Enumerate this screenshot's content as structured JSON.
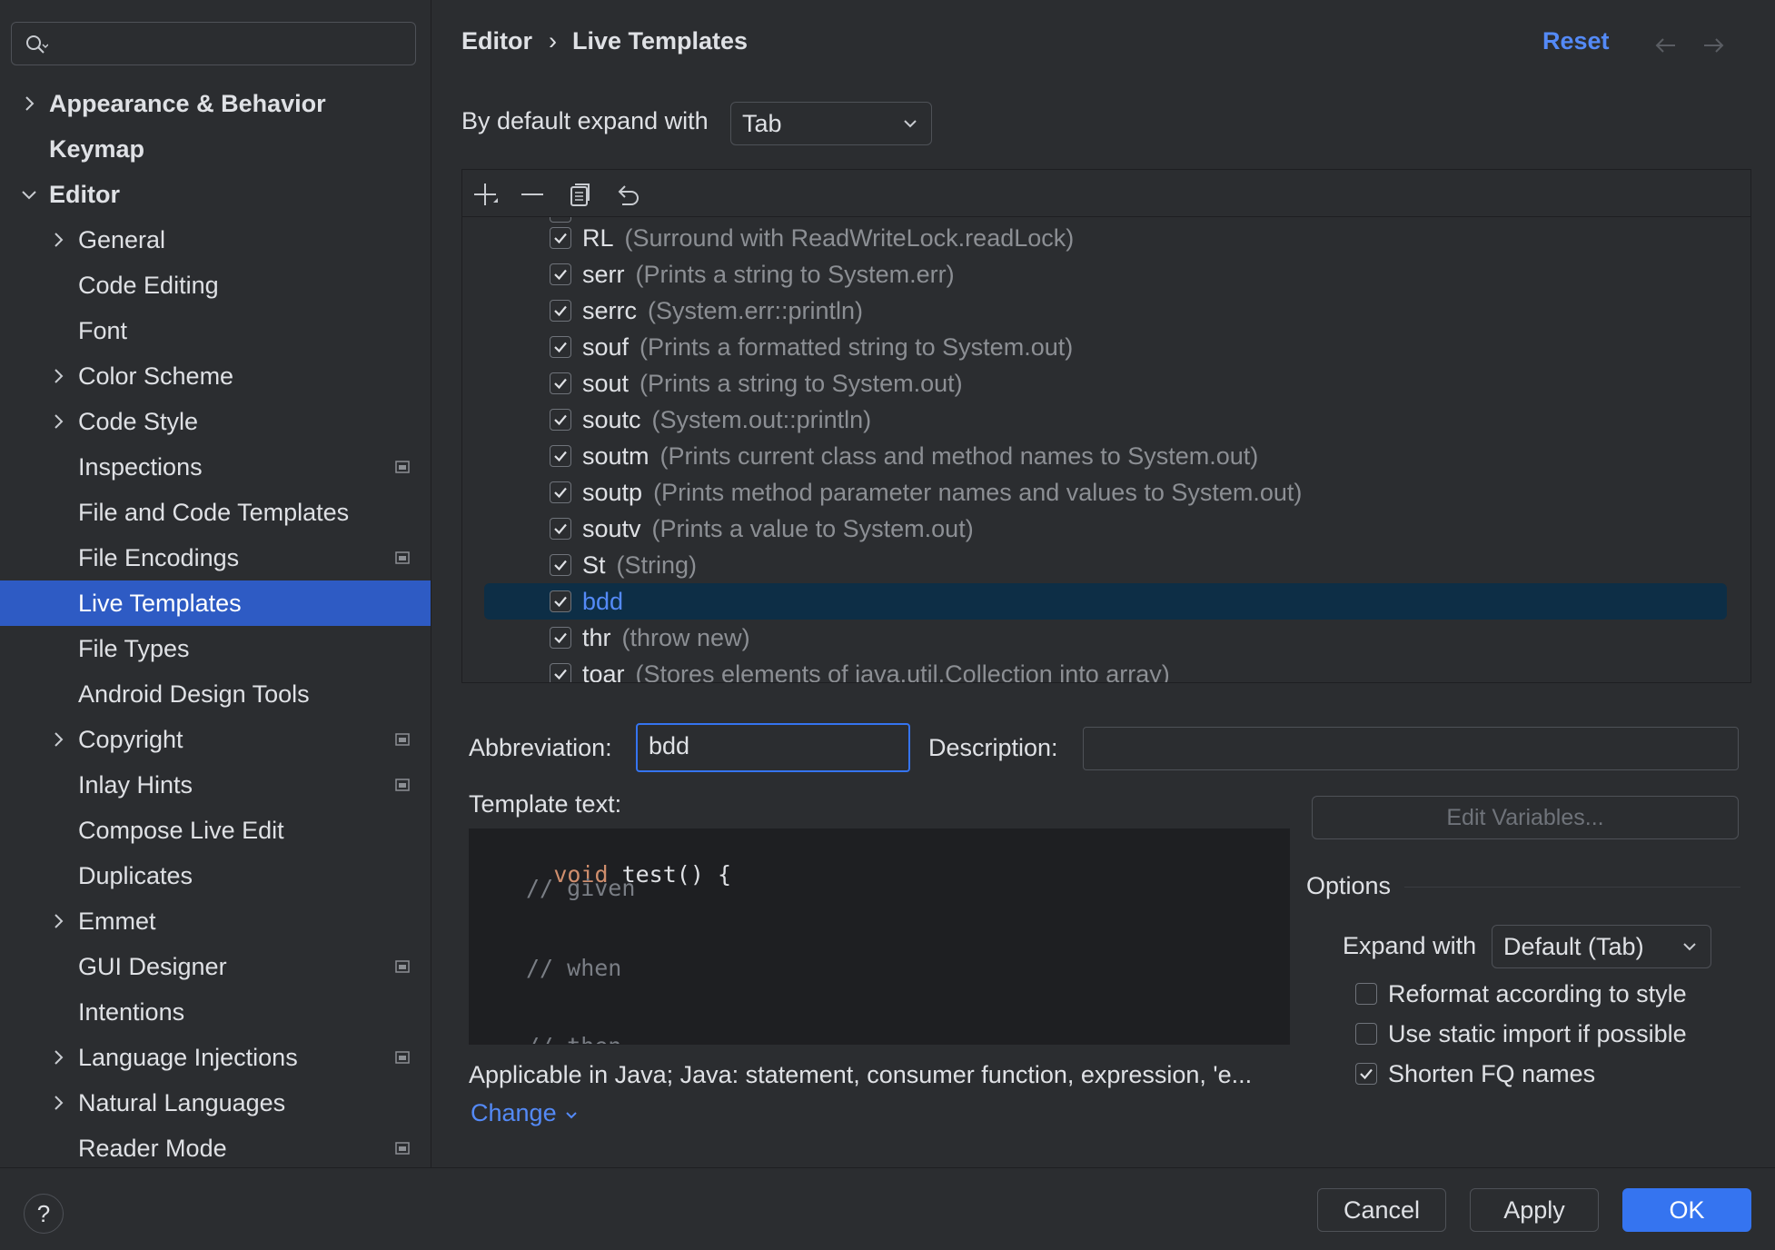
{
  "search": {
    "placeholder": ""
  },
  "sidebar": {
    "items": [
      {
        "label": "Appearance & Behavior",
        "level": 0,
        "expander": "collapsed",
        "bold": true,
        "project": false,
        "selected": false
      },
      {
        "label": "Keymap",
        "level": 0,
        "expander": "none",
        "bold": true,
        "project": false,
        "selected": false
      },
      {
        "label": "Editor",
        "level": 0,
        "expander": "expanded",
        "bold": true,
        "project": false,
        "selected": false
      },
      {
        "label": "General",
        "level": 1,
        "expander": "collapsed",
        "bold": false,
        "project": false,
        "selected": false
      },
      {
        "label": "Code Editing",
        "level": 1,
        "expander": "none",
        "bold": false,
        "project": false,
        "selected": false
      },
      {
        "label": "Font",
        "level": 1,
        "expander": "none",
        "bold": false,
        "project": false,
        "selected": false
      },
      {
        "label": "Color Scheme",
        "level": 1,
        "expander": "collapsed",
        "bold": false,
        "project": false,
        "selected": false
      },
      {
        "label": "Code Style",
        "level": 1,
        "expander": "collapsed",
        "bold": false,
        "project": false,
        "selected": false
      },
      {
        "label": "Inspections",
        "level": 1,
        "expander": "none",
        "bold": false,
        "project": true,
        "selected": false
      },
      {
        "label": "File and Code Templates",
        "level": 1,
        "expander": "none",
        "bold": false,
        "project": false,
        "selected": false
      },
      {
        "label": "File Encodings",
        "level": 1,
        "expander": "none",
        "bold": false,
        "project": true,
        "selected": false
      },
      {
        "label": "Live Templates",
        "level": 1,
        "expander": "none",
        "bold": false,
        "project": false,
        "selected": true
      },
      {
        "label": "File Types",
        "level": 1,
        "expander": "none",
        "bold": false,
        "project": false,
        "selected": false
      },
      {
        "label": "Android Design Tools",
        "level": 1,
        "expander": "none",
        "bold": false,
        "project": false,
        "selected": false
      },
      {
        "label": "Copyright",
        "level": 1,
        "expander": "collapsed",
        "bold": false,
        "project": true,
        "selected": false
      },
      {
        "label": "Inlay Hints",
        "level": 1,
        "expander": "none",
        "bold": false,
        "project": true,
        "selected": false
      },
      {
        "label": "Compose Live Edit",
        "level": 1,
        "expander": "none",
        "bold": false,
        "project": false,
        "selected": false
      },
      {
        "label": "Duplicates",
        "level": 1,
        "expander": "none",
        "bold": false,
        "project": false,
        "selected": false
      },
      {
        "label": "Emmet",
        "level": 1,
        "expander": "collapsed",
        "bold": false,
        "project": false,
        "selected": false
      },
      {
        "label": "GUI Designer",
        "level": 1,
        "expander": "none",
        "bold": false,
        "project": true,
        "selected": false
      },
      {
        "label": "Intentions",
        "level": 1,
        "expander": "none",
        "bold": false,
        "project": false,
        "selected": false
      },
      {
        "label": "Language Injections",
        "level": 1,
        "expander": "collapsed",
        "bold": false,
        "project": true,
        "selected": false
      },
      {
        "label": "Natural Languages",
        "level": 1,
        "expander": "collapsed",
        "bold": false,
        "project": false,
        "selected": false
      },
      {
        "label": "Reader Mode",
        "level": 1,
        "expander": "none",
        "bold": false,
        "project": true,
        "selected": false
      }
    ]
  },
  "header": {
    "breadcrumb_parent": "Editor",
    "breadcrumb_sep": "›",
    "breadcrumb_current": "Live Templates",
    "reset_label": "Reset"
  },
  "expand": {
    "label": "By default expand with",
    "value": "Tab"
  },
  "templates": [
    {
      "abbr": "RL",
      "desc": "(Surround with ReadWriteLock.readLock)",
      "checked": true,
      "selected": false
    },
    {
      "abbr": "serr",
      "desc": "(Prints a string to System.err)",
      "checked": true,
      "selected": false
    },
    {
      "abbr": "serrc",
      "desc": "(System.err::println)",
      "checked": true,
      "selected": false
    },
    {
      "abbr": "souf",
      "desc": "(Prints a formatted string to System.out)",
      "checked": true,
      "selected": false
    },
    {
      "abbr": "sout",
      "desc": "(Prints a string to System.out)",
      "checked": true,
      "selected": false
    },
    {
      "abbr": "soutc",
      "desc": "(System.out::println)",
      "checked": true,
      "selected": false
    },
    {
      "abbr": "soutm",
      "desc": "(Prints current class and method names to System.out)",
      "checked": true,
      "selected": false
    },
    {
      "abbr": "soutp",
      "desc": "(Prints method parameter names and values to System.out)",
      "checked": true,
      "selected": false
    },
    {
      "abbr": "soutv",
      "desc": "(Prints a value to System.out)",
      "checked": true,
      "selected": false
    },
    {
      "abbr": "St",
      "desc": "(String)",
      "checked": true,
      "selected": false
    },
    {
      "abbr": "bdd",
      "desc": "",
      "checked": true,
      "selected": true
    },
    {
      "abbr": "thr",
      "desc": "(throw new)",
      "checked": true,
      "selected": false
    },
    {
      "abbr": "toar",
      "desc": "(Stores elements of java.util.Collection into array)",
      "checked": true,
      "selected": false
    }
  ],
  "form": {
    "abbreviation_label": "Abbreviation:",
    "abbreviation_value": "bdd",
    "description_label": "Description:",
    "description_value": "",
    "template_text_label": "Template text:",
    "code": {
      "keyword": "void",
      "signature": " test() {",
      "comment_given": "// given",
      "comment_when": "// when",
      "comment_then": "// then"
    },
    "edit_variables_label": "Edit Variables...",
    "options_label": "Options",
    "expand_with_label": "Expand with",
    "expand_with_value": "Default (Tab)",
    "reformat_label": "Reformat according to style",
    "reformat_checked": false,
    "static_import_label": "Use static import if possible",
    "static_import_checked": false,
    "shorten_fq_label": "Shorten FQ names",
    "shorten_fq_checked": true,
    "applicable_text": "Applicable in Java; Java: statement, consumer function, expression, 'e...",
    "change_label": "Change"
  },
  "footer": {
    "help_label": "?",
    "cancel_label": "Cancel",
    "apply_label": "Apply",
    "ok_label": "OK"
  },
  "colors": {
    "background": "#2b2d30",
    "selection": "#2e5bc4",
    "list_selection": "#0d2e46",
    "accent": "#548af7",
    "primary_button": "#3574f0"
  }
}
